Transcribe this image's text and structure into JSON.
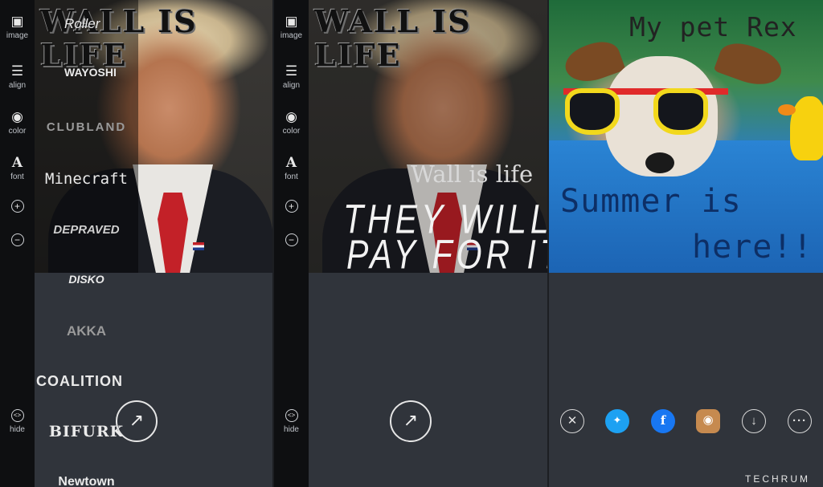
{
  "toolbar": {
    "image": "image",
    "align": "align",
    "color": "color",
    "font": "font",
    "plus": "+",
    "minus": "−",
    "hide": "hide",
    "hide_icon": "<>"
  },
  "panel1": {
    "title": "WALL IS LIFE",
    "fonts": [
      "Roller",
      "WAYOSHI",
      "CLUBLAND",
      "Minecraft",
      "DEPRAVED",
      "DISKO",
      "AKKA",
      "COALITION",
      "BIFURK",
      "Newtown"
    ]
  },
  "panel2": {
    "title": "WALL IS LIFE",
    "caption_serif": "Wall is life",
    "caption_line1": "THEY WILL",
    "caption_line2": "PAY FOR IT"
  },
  "panel3": {
    "caption_top": "My pet Rex",
    "caption_mid": "Summer is",
    "caption_bot": "here!!",
    "watermark": "TECHRUM",
    "share_icons": [
      "close-icon",
      "twitter-icon",
      "facebook-icon",
      "instagram-icon",
      "download-icon",
      "more-icon"
    ]
  },
  "colors": {
    "toolbar_bg": "#0e0f11",
    "panel_bg": "#30343b",
    "twitter": "#1da1f2",
    "facebook": "#1877f2",
    "instagram": "#c68a4f"
  }
}
